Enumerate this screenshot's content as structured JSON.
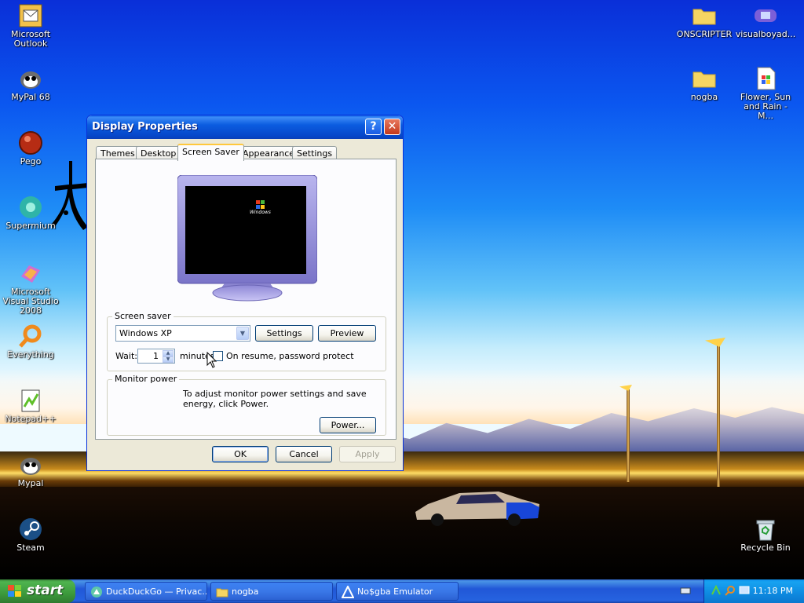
{
  "desktop_icons": [
    {
      "label": "Microsoft Outlook",
      "icon": "outlook-icon"
    },
    {
      "label": "MyPal 68",
      "icon": "mypal-icon"
    },
    {
      "label": "Pego",
      "icon": "pego-icon"
    },
    {
      "label": "Supermium",
      "icon": "supermium-icon"
    },
    {
      "label": "Microsoft Visual Studio 2008",
      "icon": "visual-studio-icon"
    },
    {
      "label": "Everything",
      "icon": "everything-icon"
    },
    {
      "label": "Notepad++",
      "icon": "notepadpp-icon"
    },
    {
      "label": "Mypal",
      "icon": "mypal-icon"
    },
    {
      "label": "Steam",
      "icon": "steam-icon"
    },
    {
      "label": "ONSCRIPTER",
      "icon": "folder-icon"
    },
    {
      "label": "visualboyad...",
      "icon": "gameboy-icon"
    },
    {
      "label": "nogba",
      "icon": "folder-icon"
    },
    {
      "label": "Flower, Sun and Rain - M...",
      "icon": "document-icon"
    },
    {
      "label": "Recycle Bin",
      "icon": "recycle-bin-icon"
    }
  ],
  "window": {
    "title": "Display Properties",
    "help_glyph": "?",
    "close_glyph": "✕",
    "tabs": [
      "Themes",
      "Desktop",
      "Screen Saver",
      "Appearance",
      "Settings"
    ],
    "active_tab": "Screen Saver",
    "preview": {
      "logo_text": "Windows"
    },
    "screen_saver": {
      "group_label": "Screen saver",
      "selected": "Windows XP",
      "settings_label": "Settings",
      "preview_label": "Preview",
      "wait_label": "Wait:",
      "wait_value": "1",
      "minutes_label": "minutes",
      "password_label": "On resume, password protect",
      "password_checked": false
    },
    "monitor_power": {
      "group_label": "Monitor power",
      "description": "To adjust monitor power settings and save energy, click Power.",
      "power_label": "Power..."
    },
    "footer": {
      "ok": "OK",
      "cancel": "Cancel",
      "apply": "Apply"
    }
  },
  "taskbar": {
    "start_label": "start",
    "tasks": [
      {
        "label": "DuckDuckGo — Privac...",
        "icon": "browser-icon"
      },
      {
        "label": "nogba",
        "icon": "folder-icon"
      },
      {
        "label": "No$gba Emulator",
        "icon": "nogba-icon"
      }
    ],
    "clock": "11:18 PM"
  },
  "colors": {
    "title_blue": "#0646c9",
    "start_green": "#3c9a3c",
    "tab_highlight": "#ffc83c"
  }
}
